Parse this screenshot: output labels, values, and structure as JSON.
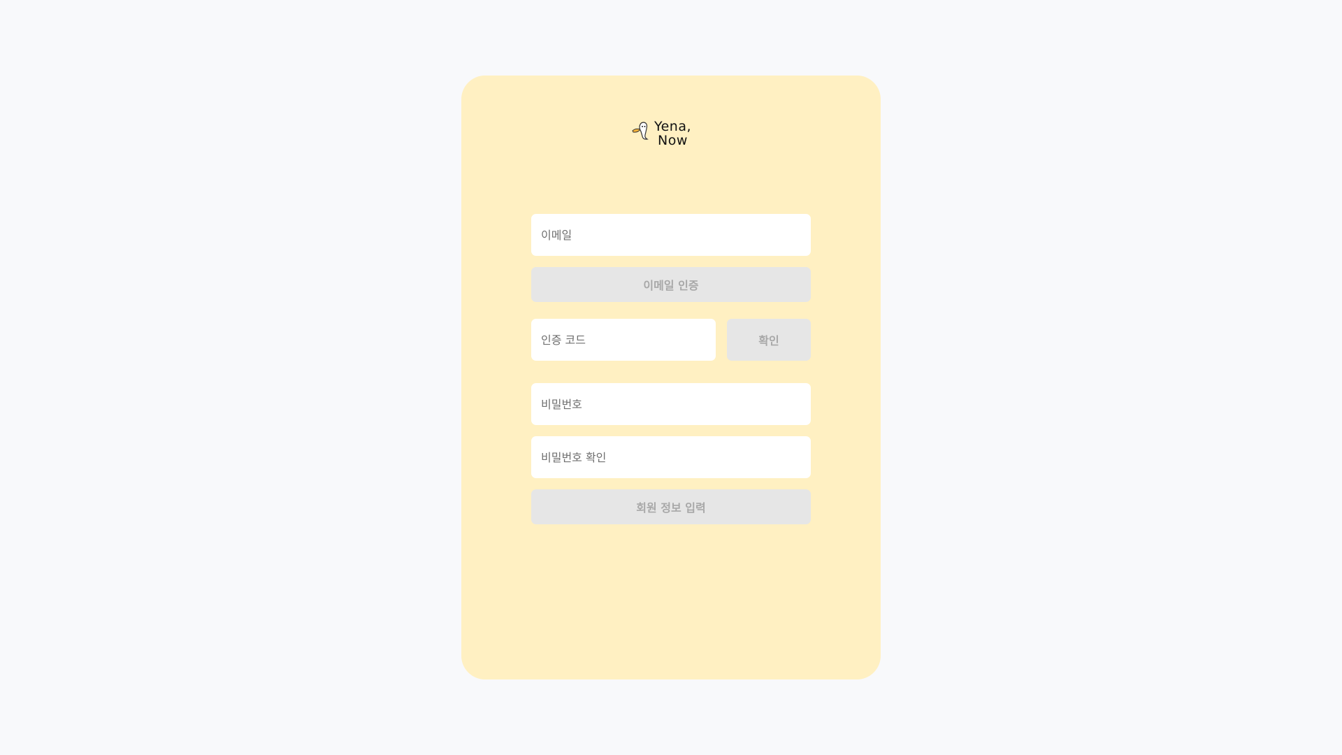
{
  "logo": {
    "line1": "Yena,",
    "line2": "Now"
  },
  "form": {
    "email_placeholder": "이메일",
    "verify_email_label": "이메일 인증",
    "code_placeholder": "인증 코드",
    "confirm_label": "확인",
    "password_placeholder": "비밀번호",
    "password_confirm_placeholder": "비밀번호 확인",
    "submit_label": "회원 정보 입력"
  },
  "colors": {
    "page_background": "#f8f9fb",
    "card_background": "#fff0c2",
    "input_background": "#ffffff",
    "disabled_button_background": "#e6e6e6",
    "disabled_button_text": "#a8a8a8"
  }
}
